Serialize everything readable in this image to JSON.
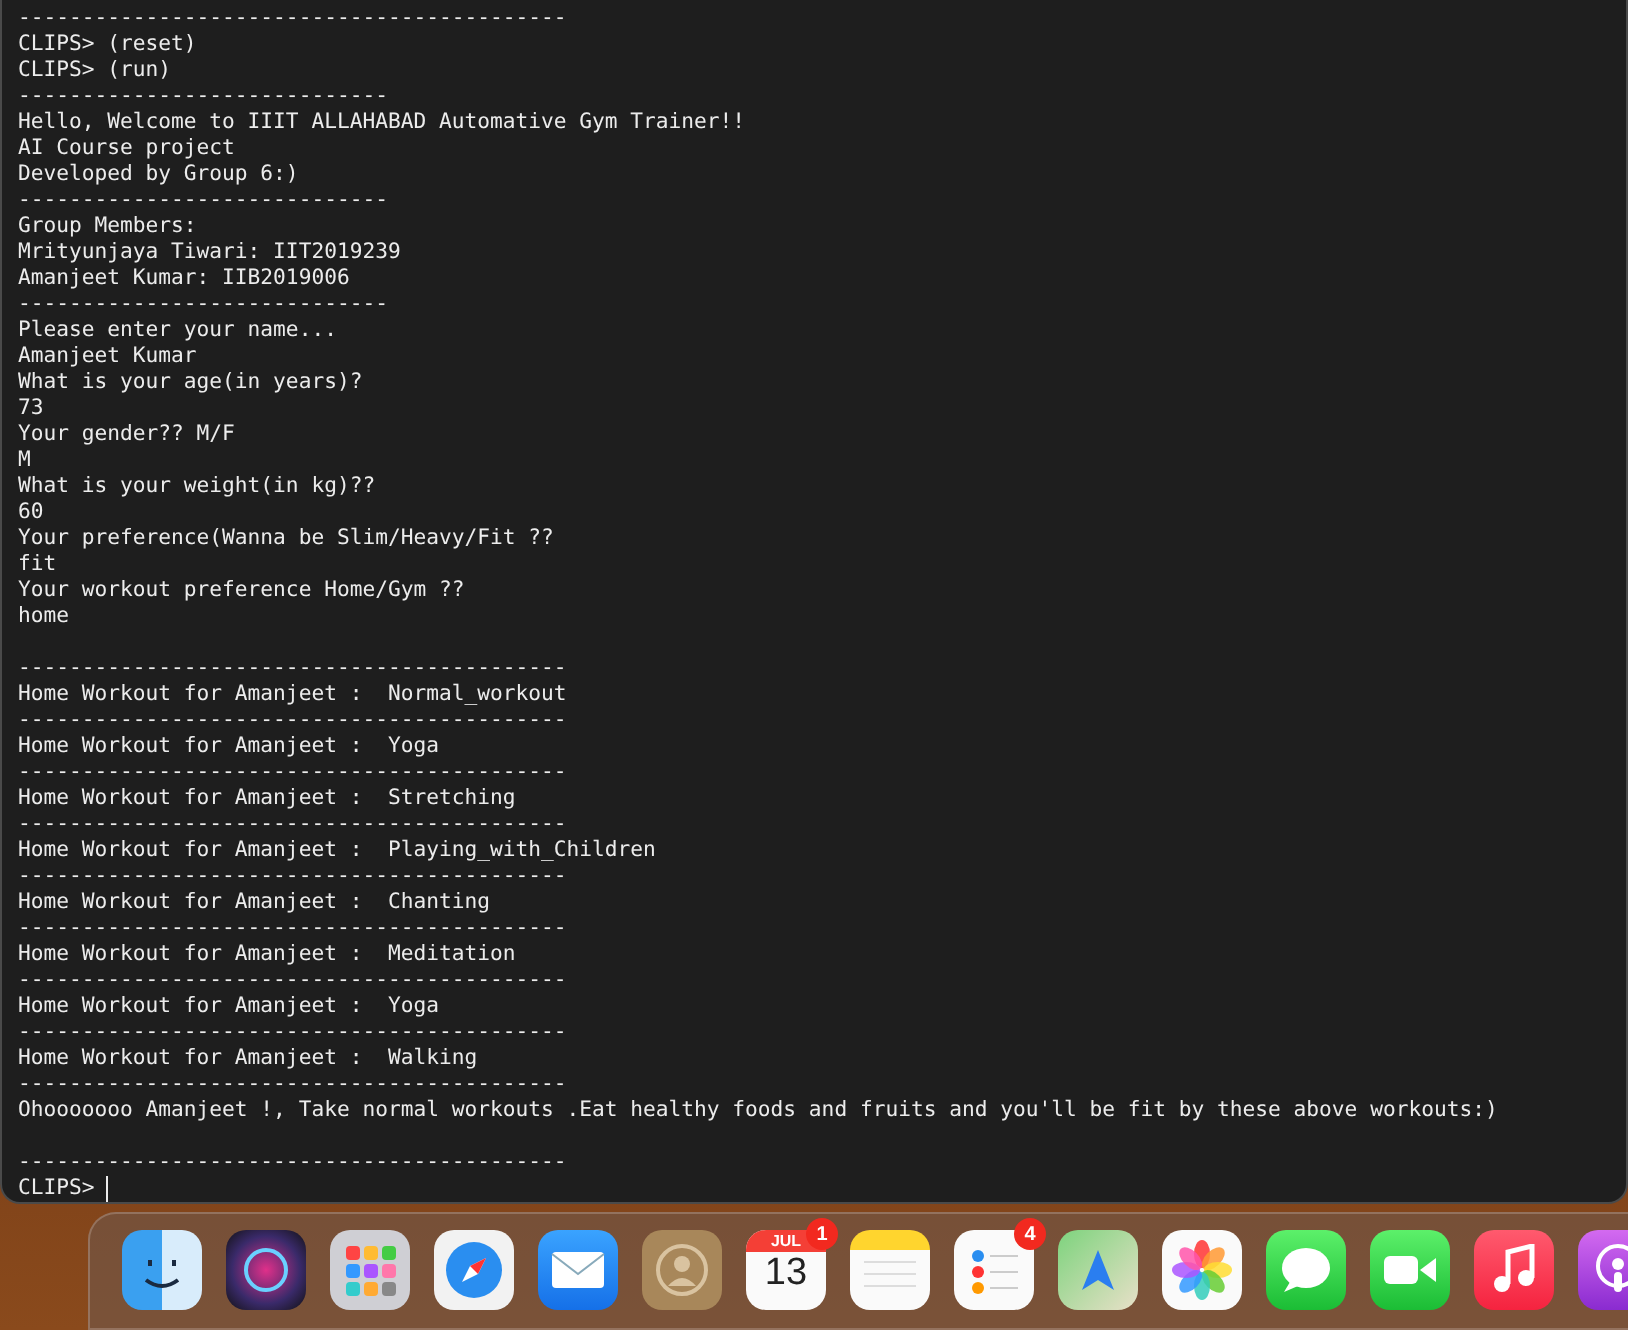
{
  "terminal": {
    "lines": [
      {
        "kind": "text",
        "text": "-------------------------------------------"
      },
      {
        "kind": "text",
        "text": "CLIPS> (reset)"
      },
      {
        "kind": "text",
        "text": "CLIPS> (run)"
      },
      {
        "kind": "text",
        "text": "-----------------------------"
      },
      {
        "kind": "text",
        "text": "Hello, Welcome to IIIT ALLAHABAD Automative Gym Trainer!!"
      },
      {
        "kind": "text",
        "text": "AI Course project"
      },
      {
        "kind": "text",
        "text": "Developed by Group 6:)"
      },
      {
        "kind": "text",
        "text": "-----------------------------"
      },
      {
        "kind": "text",
        "text": "Group Members:"
      },
      {
        "kind": "text",
        "text": "Mrityunjaya Tiwari: IIT2019239"
      },
      {
        "kind": "text",
        "text": "Amanjeet Kumar: IIB2019006"
      },
      {
        "kind": "text",
        "text": "-----------------------------"
      },
      {
        "kind": "text",
        "text": "Please enter your name..."
      },
      {
        "kind": "text",
        "text": "Amanjeet Kumar"
      },
      {
        "kind": "text",
        "text": "What is your age(in years)?"
      },
      {
        "kind": "text",
        "text": "73"
      },
      {
        "kind": "text",
        "text": "Your gender?? M/F"
      },
      {
        "kind": "text",
        "text": "M"
      },
      {
        "kind": "text",
        "text": "What is your weight(in kg)??"
      },
      {
        "kind": "text",
        "text": "60"
      },
      {
        "kind": "text",
        "text": "Your preference(Wanna be Slim/Heavy/Fit ??"
      },
      {
        "kind": "text",
        "text": "fit"
      },
      {
        "kind": "text",
        "text": "Your workout preference Home/Gym ??"
      },
      {
        "kind": "text",
        "text": "home"
      },
      {
        "kind": "blank"
      },
      {
        "kind": "text",
        "text": "-------------------------------------------"
      },
      {
        "kind": "text",
        "text": "Home Workout for Amanjeet :  Normal_workout"
      },
      {
        "kind": "text",
        "text": "-------------------------------------------"
      },
      {
        "kind": "text",
        "text": "Home Workout for Amanjeet :  Yoga"
      },
      {
        "kind": "text",
        "text": "-------------------------------------------"
      },
      {
        "kind": "text",
        "text": "Home Workout for Amanjeet :  Stretching"
      },
      {
        "kind": "text",
        "text": "-------------------------------------------"
      },
      {
        "kind": "text",
        "text": "Home Workout for Amanjeet :  Playing_with_Children"
      },
      {
        "kind": "text",
        "text": "-------------------------------------------"
      },
      {
        "kind": "text",
        "text": "Home Workout for Amanjeet :  Chanting"
      },
      {
        "kind": "text",
        "text": "-------------------------------------------"
      },
      {
        "kind": "text",
        "text": "Home Workout for Amanjeet :  Meditation"
      },
      {
        "kind": "text",
        "text": "-------------------------------------------"
      },
      {
        "kind": "text",
        "text": "Home Workout for Amanjeet :  Yoga"
      },
      {
        "kind": "text",
        "text": "-------------------------------------------"
      },
      {
        "kind": "text",
        "text": "Home Workout for Amanjeet :  Walking"
      },
      {
        "kind": "text",
        "text": "-------------------------------------------"
      },
      {
        "kind": "text",
        "text": "Ohooooooo Amanjeet !, Take normal workouts .Eat healthy foods and fruits and you'll be fit by these above workouts:)"
      },
      {
        "kind": "blank"
      },
      {
        "kind": "text",
        "text": "-------------------------------------------"
      },
      {
        "kind": "prompt",
        "text": "CLIPS>"
      }
    ]
  },
  "dock": {
    "apps": [
      {
        "kind": "finder"
      },
      {
        "kind": "siri"
      },
      {
        "kind": "launchpad"
      },
      {
        "kind": "safari"
      },
      {
        "kind": "mail"
      },
      {
        "kind": "contacts"
      },
      {
        "kind": "calendar",
        "month": "JUL",
        "day": "13",
        "badge": "1"
      },
      {
        "kind": "notes"
      },
      {
        "kind": "reminders",
        "badge": "4"
      },
      {
        "kind": "maps"
      },
      {
        "kind": "photos"
      },
      {
        "kind": "messages"
      },
      {
        "kind": "facetime"
      },
      {
        "kind": "music"
      },
      {
        "kind": "podcasts"
      }
    ]
  }
}
